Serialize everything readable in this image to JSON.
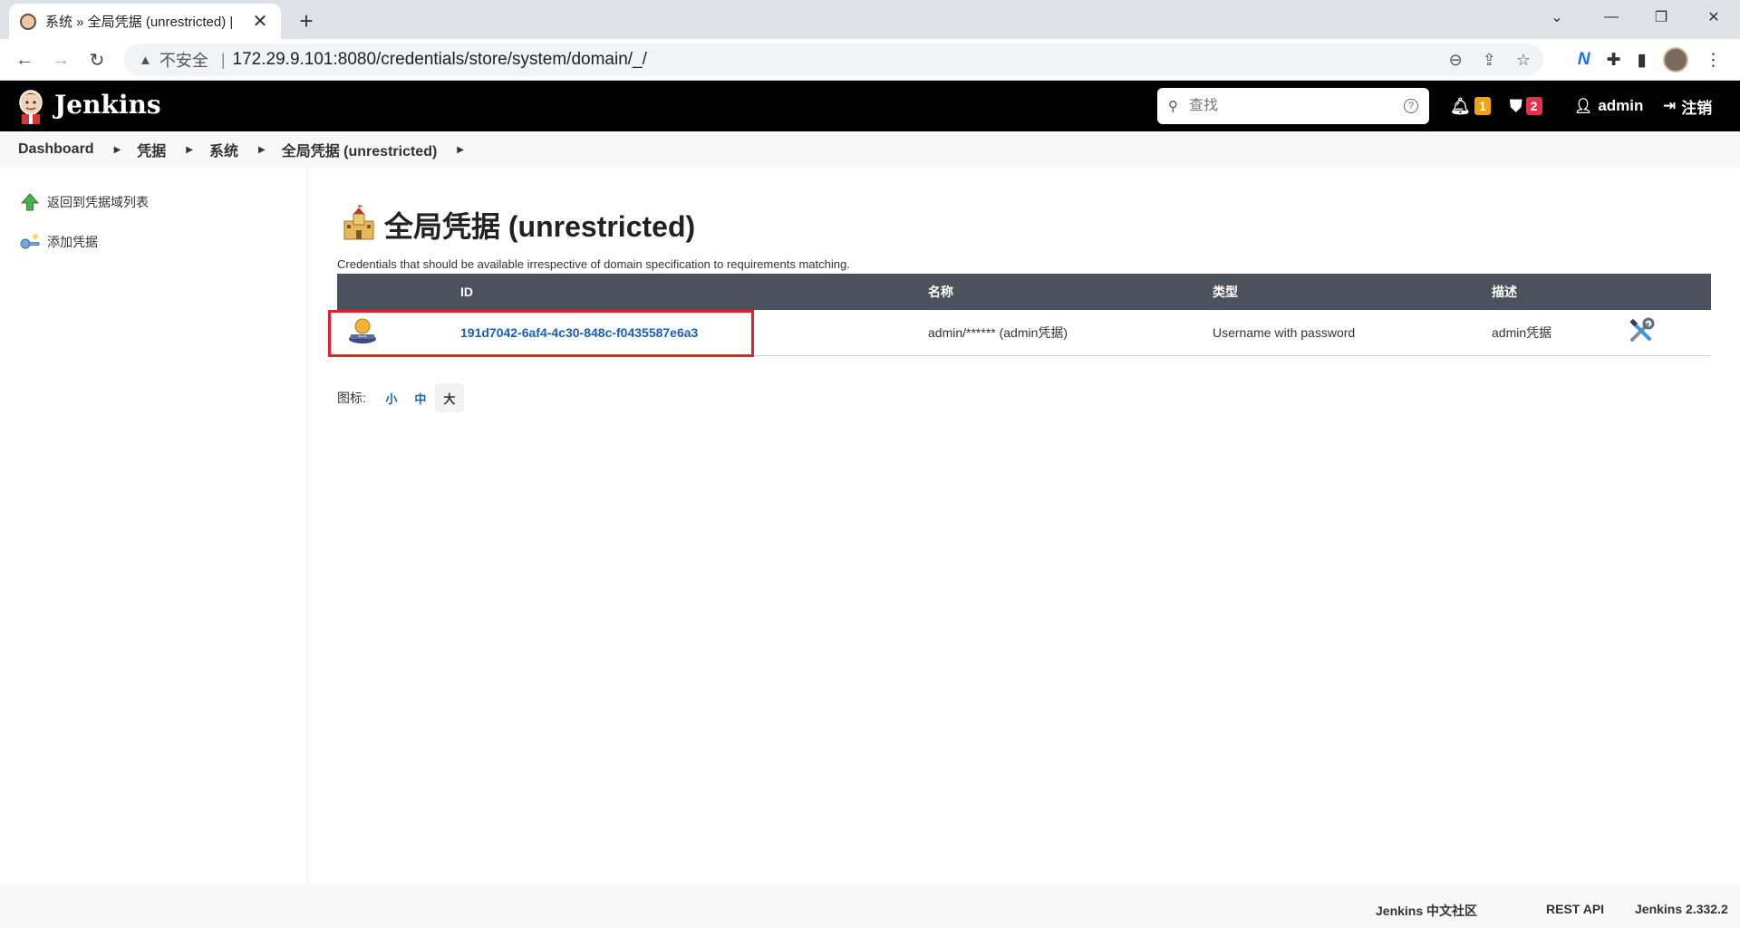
{
  "browser": {
    "tab_title": "系统 » 全局凭据 (unrestricted) |",
    "insecure_label": "不安全",
    "url": "172.29.9.101:8080/credentials/store/system/domain/_/"
  },
  "header": {
    "title": "Jenkins",
    "search_placeholder": "查找",
    "notifications_count": "1",
    "security_count": "2",
    "user": "admin",
    "logout": "注销"
  },
  "breadcrumb": [
    "Dashboard",
    "凭据",
    "系统",
    "全局凭据 (unrestricted)"
  ],
  "sidebar": {
    "items": [
      {
        "label": "返回到凭据域列表",
        "icon": "up-arrow-icon"
      },
      {
        "label": "添加凭据",
        "icon": "key-icon"
      }
    ]
  },
  "main": {
    "title": "全局凭据 (unrestricted)",
    "subtitle": "Credentials that should be available irrespective of domain specification to requirements matching.",
    "table": {
      "headers": {
        "id": "ID",
        "name": "名称",
        "type": "类型",
        "description": "描述"
      },
      "rows": [
        {
          "id": "191d7042-6af4-4c30-848c-f0435587e6a3",
          "name": "admin/****** (admin凭据)",
          "type": "Username with password",
          "description": "admin凭据"
        }
      ]
    },
    "icon_size": {
      "label": "图标:",
      "small": "小",
      "medium": "中",
      "large": "大",
      "selected": "大"
    }
  },
  "footer": {
    "community": "Jenkins 中文社区",
    "rest_api": "REST API",
    "version": "Jenkins 2.332.2"
  },
  "colors": {
    "header_bg": "#000000",
    "table_header_bg": "#4b525b",
    "link": "#1a5fb4",
    "highlight": "#e0222a",
    "badge_orange": "#f3a013",
    "badge_red": "#e3334c"
  }
}
